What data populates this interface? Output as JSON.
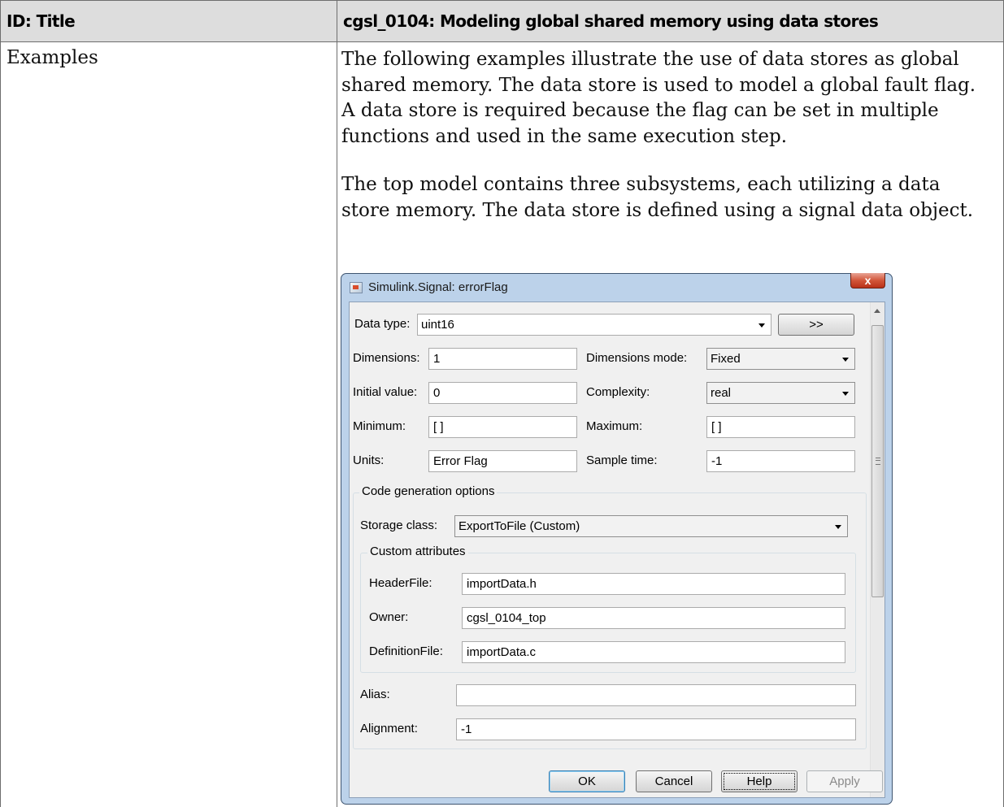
{
  "table": {
    "header_left": "ID: Title",
    "header_right": "cgsl_0104: Modeling global shared memory using data stores",
    "row_label": "Examples",
    "paragraph1": "The following examples illustrate the use of data stores as global shared memory. The data store is used to model a global fault flag. A data store is required because the flag can be set in multiple functions and used in the same execution step.",
    "paragraph2": "The top model contains three subsystems, each utilizing a data store memory. The data store is defined using a signal data object."
  },
  "dialog": {
    "title": "Simulink.Signal: errorFlag",
    "close_glyph": "x",
    "fields": {
      "data_type_label": "Data type:",
      "data_type_value": "uint16",
      "expand_button": ">>",
      "dimensions_label": "Dimensions:",
      "dimensions_value": "1",
      "dimensions_mode_label": "Dimensions mode:",
      "dimensions_mode_value": "Fixed",
      "initial_value_label": "Initial value:",
      "initial_value_value": "0",
      "complexity_label": "Complexity:",
      "complexity_value": "real",
      "minimum_label": "Minimum:",
      "minimum_value": "[ ]",
      "maximum_label": "Maximum:",
      "maximum_value": "[ ]",
      "units_label": "Units:",
      "units_value": "Error Flag",
      "sample_time_label": "Sample time:",
      "sample_time_value": "-1"
    },
    "code_gen": {
      "group_title": "Code generation options",
      "storage_class_label": "Storage class:",
      "storage_class_value": "ExportToFile (Custom)",
      "custom_title": "Custom attributes",
      "header_file_label": "HeaderFile:",
      "header_file_value": "importData.h",
      "owner_label": "Owner:",
      "owner_value": "cgsl_0104_top",
      "definition_file_label": "DefinitionFile:",
      "definition_file_value": "importData.c",
      "alias_label": "Alias:",
      "alias_value": "",
      "alignment_label": "Alignment:",
      "alignment_value": "-1"
    },
    "buttons": {
      "ok": "OK",
      "cancel": "Cancel",
      "help": "Help",
      "apply": "Apply"
    }
  }
}
